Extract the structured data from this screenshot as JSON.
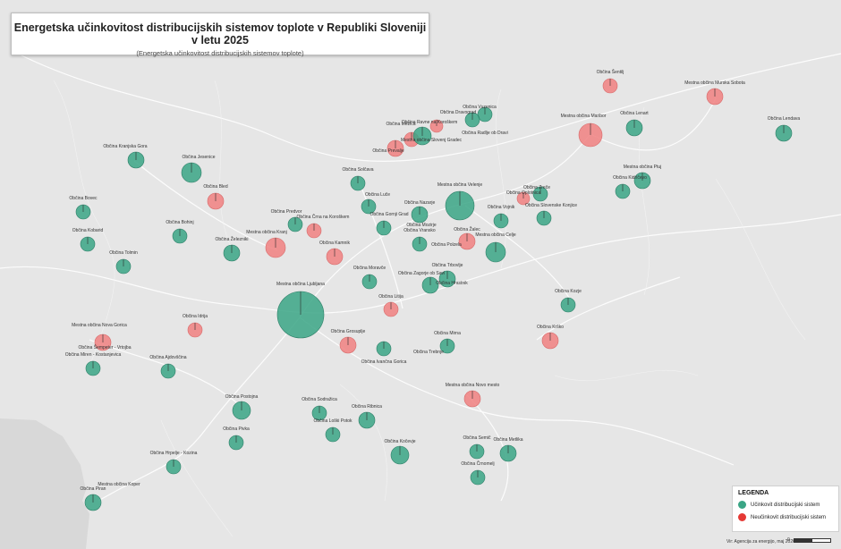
{
  "title": "Energetska učinkovitost distribucijskih sistemov toplote v Republiki Sloveniji v letu 2025",
  "subtitle": "(Energetska učinkovitost distribucijskih sistemov toplote)",
  "legend": {
    "title": "LEGENDA",
    "efficient_label": "Učinkovit distribucijski sistem",
    "inefficient_label": "Neučinkovit distribucijski sistem"
  },
  "source": "Vir: Agencija za energijo, maj 2026",
  "scale_label": "0",
  "colors": {
    "efficient": "#3aa585",
    "inefficient": "#f08080",
    "map_background": "#e6e6e6",
    "roads": "#ffffff"
  },
  "markers": [
    {
      "name": "Občina Šentilj",
      "status": "inefficient"
    },
    {
      "name": "Mestna občina Murska Sobota",
      "status": "inefficient"
    },
    {
      "name": "Občina Vuzenica",
      "status": "efficient"
    },
    {
      "name": "Občina Dravograd",
      "status": "efficient"
    },
    {
      "name": "Občina Radlje ob Dravi",
      "status": "efficient"
    },
    {
      "name": "Občina Ravne na Koroškem",
      "status": "inefficient"
    },
    {
      "name": "Občina Mežica",
      "status": "inefficient"
    },
    {
      "name": "Občina Prevalje",
      "status": "inefficient"
    },
    {
      "name": "Mestna občina Slovenj Gradec",
      "status": "efficient"
    },
    {
      "name": "Mestna občina Maribor",
      "status": "inefficient"
    },
    {
      "name": "Občina Lenart",
      "status": "efficient"
    },
    {
      "name": "Občina Lendava",
      "status": "efficient"
    },
    {
      "name": "Občina Kranjska Gora",
      "status": "efficient"
    },
    {
      "name": "Občina Jesenice",
      "status": "efficient"
    },
    {
      "name": "Mestna občina Ptuj",
      "status": "efficient"
    },
    {
      "name": "Občina Kidričevo",
      "status": "efficient"
    },
    {
      "name": "Občina Solčava",
      "status": "efficient"
    },
    {
      "name": "Mestna občina Velenje",
      "status": "efficient"
    },
    {
      "name": "Občina Zreče",
      "status": "efficient"
    },
    {
      "name": "Občina Oplotnica",
      "status": "inefficient"
    },
    {
      "name": "Občina Slovenske Konjice",
      "status": "efficient"
    },
    {
      "name": "Občina Bled",
      "status": "inefficient"
    },
    {
      "name": "Občina Bovec",
      "status": "efficient"
    },
    {
      "name": "Občina Luče",
      "status": "efficient"
    },
    {
      "name": "Občina Predvor",
      "status": "efficient"
    },
    {
      "name": "Občina Črna na Koroškem",
      "status": "inefficient"
    },
    {
      "name": "Občina Gornji Grad",
      "status": "efficient"
    },
    {
      "name": "Občina Nazarje",
      "status": "efficient"
    },
    {
      "name": "Občina Mozirje",
      "status": "efficient"
    },
    {
      "name": "Občina Vransko",
      "status": "efficient"
    },
    {
      "name": "Občina Vojnik",
      "status": "efficient"
    },
    {
      "name": "Občina Bohinj",
      "status": "efficient"
    },
    {
      "name": "Mestna občina Kranj",
      "status": "inefficient"
    },
    {
      "name": "Občina Kobarid",
      "status": "efficient"
    },
    {
      "name": "Občina Železniki",
      "status": "efficient"
    },
    {
      "name": "Občina Žalec",
      "status": "inefficient"
    },
    {
      "name": "Občina Polzela",
      "status": "efficient"
    },
    {
      "name": "Mestna občina Celje",
      "status": "efficient"
    },
    {
      "name": "Občina Kamnik",
      "status": "inefficient"
    },
    {
      "name": "Občina Tolmin",
      "status": "efficient"
    },
    {
      "name": "Občina Moravče",
      "status": "efficient"
    },
    {
      "name": "Občina Trbovlje",
      "status": "efficient"
    },
    {
      "name": "Občina Zagorje ob Savi",
      "status": "efficient"
    },
    {
      "name": "Občina Hrastnik",
      "status": "efficient"
    },
    {
      "name": "Mestna občina Ljubljana",
      "status": "efficient"
    },
    {
      "name": "Občina Litija",
      "status": "inefficient"
    },
    {
      "name": "Občina Kozje",
      "status": "efficient"
    },
    {
      "name": "Občina Idrija",
      "status": "inefficient"
    },
    {
      "name": "Občina Krško",
      "status": "inefficient"
    },
    {
      "name": "Mestna občina Nova Gorica",
      "status": "inefficient"
    },
    {
      "name": "Občina Šempeter - Vrtojba",
      "status": "inefficient"
    },
    {
      "name": "Občina Grosuplje",
      "status": "inefficient"
    },
    {
      "name": "Občina Mirna",
      "status": "efficient"
    },
    {
      "name": "Občina Miren - Kostanjevica",
      "status": "efficient"
    },
    {
      "name": "Občina Trebnje",
      "status": "efficient"
    },
    {
      "name": "Občina Ajdovščina",
      "status": "efficient"
    },
    {
      "name": "Občina Ivančna Gorica",
      "status": "efficient"
    },
    {
      "name": "Mestna občina Novo mesto",
      "status": "inefficient"
    },
    {
      "name": "Občina Postojna",
      "status": "efficient"
    },
    {
      "name": "Občina Sodražica",
      "status": "efficient"
    },
    {
      "name": "Občina Ribnica",
      "status": "efficient"
    },
    {
      "name": "Občina Loški Potok",
      "status": "efficient"
    },
    {
      "name": "Občina Pivka",
      "status": "efficient"
    },
    {
      "name": "Občina Kočevje",
      "status": "efficient"
    },
    {
      "name": "Občina Semič",
      "status": "efficient"
    },
    {
      "name": "Občina Metlika",
      "status": "efficient"
    },
    {
      "name": "Občina Hrpelje - Kozina",
      "status": "efficient"
    },
    {
      "name": "Občina Črnomelj",
      "status": "efficient"
    },
    {
      "name": "Mestna občina Koper",
      "status": "inefficient"
    },
    {
      "name": "Občina Piran",
      "status": "efficient"
    }
  ]
}
